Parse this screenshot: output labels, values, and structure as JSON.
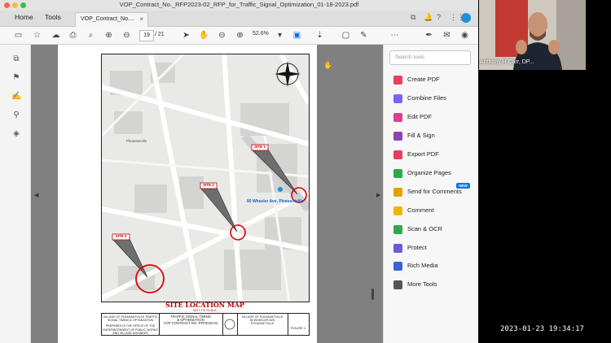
{
  "window": {
    "title": "VOP_Contract_No._RFP2023-02_RFP_for_Traffic_Signal_Optimization_01-18-2023.pdf"
  },
  "tabs": {
    "home": "Home",
    "tools": "Tools",
    "document_tab": "VOP_Contract_No....",
    "close": "×"
  },
  "toolbar": {
    "page_current": "19",
    "page_total": "/ 21",
    "zoom": "52.6%"
  },
  "map": {
    "title": "SITE LOCATION MAP",
    "scale_note": "NOT TO SCALE",
    "location_label": "80 Wheeler Ave, Pleasantville",
    "town_label": "Pleasantville",
    "sites": [
      "SITE 1",
      "SITE 2",
      "SITE 3"
    ]
  },
  "title_block": {
    "left": "VILLAGE OF PLEASANTVILLE TRAFFIC SIGNAL TIMING & OPTIMIZATION",
    "prepared": "PREPARED IN THE OFFICE OF THE SUPERINTENDENT OF PUBLIC WORKS AND VILLAGE ENGINEER",
    "middle_1": "TRAFFIC SIGNAL TIMING",
    "middle_2": "& OPTIMIZATION",
    "middle_3": "VOP CONTRACT NO. RFP2023-02",
    "right_1": "VILLAGE OF PLEASANTVILLE",
    "right_2": "80 WHEELER AVE",
    "right_3": "PLEASANTVILLE",
    "figure": "FIGURE 1"
  },
  "tools_panel": {
    "search_placeholder": "Search tools",
    "new_badge": "NEW",
    "items": [
      {
        "label": "Create PDF",
        "color": "#e4405f"
      },
      {
        "label": "Combine Files",
        "color": "#7b61ff"
      },
      {
        "label": "Edit PDF",
        "color": "#d64292"
      },
      {
        "label": "Fill & Sign",
        "color": "#8e44ad"
      },
      {
        "label": "Export PDF",
        "color": "#e4405f"
      },
      {
        "label": "Organize Pages",
        "color": "#2fa84f"
      },
      {
        "label": "Send for Comments",
        "color": "#e5a000"
      },
      {
        "label": "Comment",
        "color": "#f2b600"
      },
      {
        "label": "Scan & OCR",
        "color": "#2fa84f"
      },
      {
        "label": "Protect",
        "color": "#6b5bd6"
      },
      {
        "label": "Rich Media",
        "color": "#3a63d6"
      },
      {
        "label": "More Tools",
        "color": "#555555"
      }
    ]
  },
  "participant": {
    "name": "Anthony R Carr, DP..."
  },
  "timestamp": "2023-01-23  19:34:17"
}
